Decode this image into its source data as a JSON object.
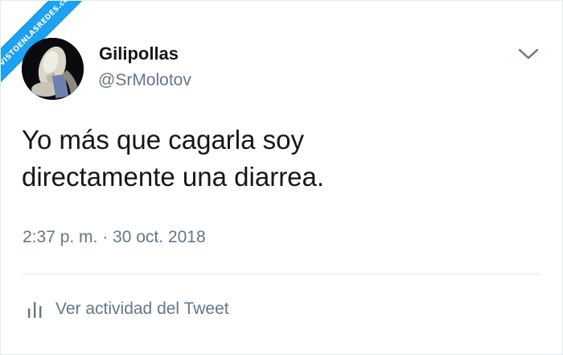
{
  "watermark": {
    "text": "VISTOENLASREDES",
    "suffix": ".com",
    "color": "#1da1f2"
  },
  "author": {
    "display_name": "Gilipollas",
    "handle": "@SrMolotov",
    "avatar_icon": "sneaker-photo-avatar"
  },
  "tweet": {
    "line1": "Yo más que cagarla soy",
    "line2": "directamente una diarrea.",
    "timestamp": "2:37 p. m. · 30 oct. 2018"
  },
  "actions": {
    "more_icon": "chevron-down-icon",
    "activity_icon": "bar-chart-icon",
    "activity_label": "Ver actividad del Tweet"
  },
  "colors": {
    "text_primary": "#14171a",
    "text_secondary": "#657786",
    "divider": "#e6ecf0"
  }
}
